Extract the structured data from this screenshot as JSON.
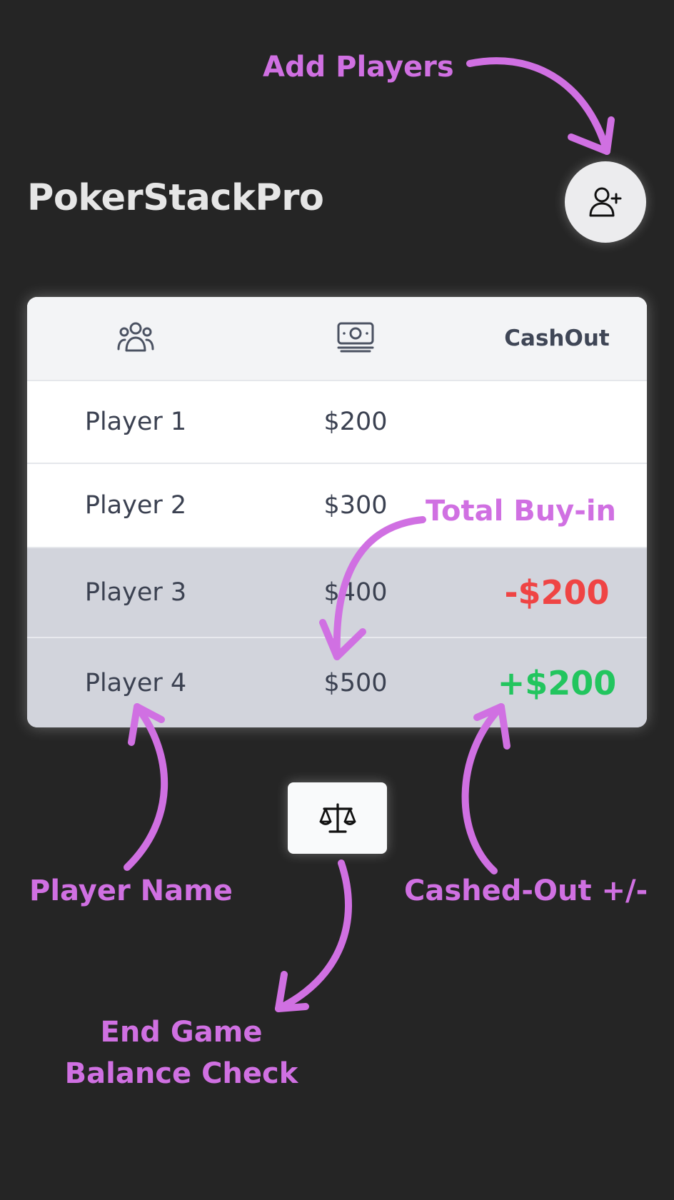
{
  "app": {
    "title": "PokerStackPro"
  },
  "header": {
    "add_player_icon": "user-plus-icon"
  },
  "table": {
    "columns": [
      {
        "icon": "players-icon"
      },
      {
        "icon": "cash-icon"
      },
      {
        "label": "CashOut"
      }
    ],
    "rows": [
      {
        "name": "Player 1",
        "buyin": "$200",
        "cashout": ""
      },
      {
        "name": "Player 2",
        "buyin": "$300",
        "cashout": ""
      },
      {
        "name": "Player 3",
        "buyin": "$400",
        "cashout": "-$200"
      },
      {
        "name": "Player 4",
        "buyin": "$500",
        "cashout": "+$200"
      }
    ]
  },
  "balance_button": {
    "icon": "scale-icon"
  },
  "annotations": {
    "add_players": "Add Players",
    "total_buyin": "Total Buy-in",
    "player_name": "Player Name",
    "cashed_out": "Cashed-Out +/-",
    "end_game_line1": "End Game",
    "end_game_line2": "Balance Check"
  },
  "colors": {
    "background": "#252525",
    "annotation": "#d070e2",
    "negative": "#ef4444",
    "positive": "#22c55e",
    "cashed_row": "#d2d4dc"
  }
}
